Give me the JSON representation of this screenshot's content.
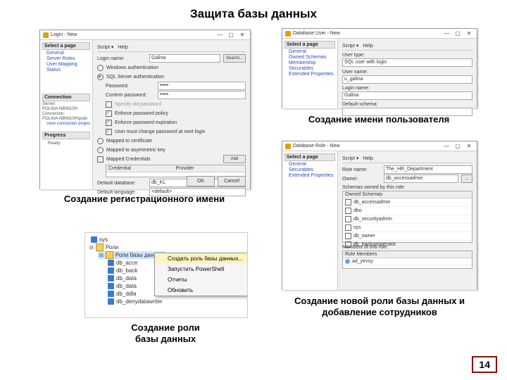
{
  "slide": {
    "title": "Защита базы данных",
    "page_number": "14",
    "captions": {
      "login": "Создание регистрационного имени",
      "user": "Создание имени пользователя",
      "role_ctx": "Создание роли\nбазы данных",
      "role_dlg": "Создание новой роли базы данных и добавление сотрудников"
    }
  },
  "login_dialog": {
    "title": "Login - New",
    "toolbar": {
      "script": "Script ▾",
      "help": "Help"
    },
    "side": {
      "header": "Select a page",
      "items": [
        "General",
        "Server Roles",
        "User Mapping",
        "Status"
      ],
      "conn_header": "Connection",
      "server_lbl": "Server:",
      "server": "POLINA-NB\\M10H",
      "conn_lbl": "Connection:",
      "conn": "POLINA-NB\\M10H\\polin",
      "view_conn": "View connection properties",
      "progress_header": "Progress",
      "progress": "Ready"
    },
    "fields": {
      "login_name_lbl": "Login name:",
      "login_name": "Galina",
      "search_btn": "Search...",
      "auth_win": "Windows authentication",
      "auth_sql": "SQL Server authentication",
      "password_lbl": "Password:",
      "password": "•••••",
      "confirm_lbl": "Confirm password:",
      "confirm": "•••••",
      "old_lbl": "Specify old password",
      "enforce_policy": "Enforce password policy",
      "enforce_exp": "Enforce password expiration",
      "must_change": "User must change password at next login",
      "mapped_cert": "Mapped to certificate",
      "mapped_key": "Mapped to asymmetric key",
      "mapped_cred": "Mapped Credentials",
      "cred_lbl": "Credential",
      "prov_lbl": "Provider",
      "add_btn": "Add",
      "def_db_lbl": "Default database:",
      "def_db": "db_KL",
      "def_lang_lbl": "Default language:",
      "def_lang": "<default>",
      "ok": "OK",
      "cancel": "Cancel"
    }
  },
  "user_dialog": {
    "title": "Database User - New",
    "toolbar": {
      "script": "Script ▾",
      "help": "Help"
    },
    "side": {
      "header": "Select a page",
      "items": [
        "General",
        "Owned Schemas",
        "Membership",
        "Securables",
        "Extended Properties"
      ]
    },
    "fields": {
      "usertype_lbl": "User type:",
      "usertype": "SQL user with login",
      "username_lbl": "User name:",
      "username": "u_galina",
      "loginname_lbl": "Login name:",
      "loginname": "Galina",
      "schema_lbl": "Default schema:"
    }
  },
  "role_dialog": {
    "title": "Database Role - New",
    "toolbar": {
      "script": "Script ▾",
      "help": "Help"
    },
    "side": {
      "header": "Select a page",
      "items": [
        "General",
        "Securables",
        "Extended Properties"
      ]
    },
    "fields": {
      "rolename_lbl": "Role name:",
      "rolename": "The_HR_Department",
      "owner_lbl": "Owner:",
      "owner": "db_accessadmin",
      "schemas_lbl": "Schemas owned by this role:",
      "schema_header": "Owned Schemas",
      "schemas": [
        "db_accessadmin",
        "dbo",
        "db_securityadmin",
        "sys",
        "db_owner",
        "db_backupoperator"
      ],
      "members_lbl": "Members of this role:",
      "member_header": "Role Members",
      "members": [
        "ad_yevsy"
      ]
    }
  },
  "tree": {
    "sys": "sys",
    "roles": "Роли",
    "role_branch": "Роли базы данных",
    "items": [
      "db_acce",
      "db_back",
      "db_data",
      "db_data",
      "db_ddla",
      "db_denydatawriter"
    ]
  },
  "ctx": {
    "create": "Создать роль базы данных...",
    "ps": "Запустить PowerShell",
    "reports": "Отчеты",
    "refresh": "Обновить"
  }
}
